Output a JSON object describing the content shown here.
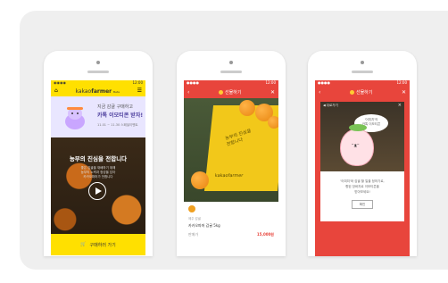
{
  "phone1": {
    "status": {
      "left": "◉◉◉◉",
      "right": "12:00"
    },
    "logo_prefix": "kakao",
    "logo_main": "farmer",
    "logo_suffix": "Beta",
    "banner_line1": "지금 감귤 구매하고",
    "banner_line2": "카톡 이모티콘 받자!",
    "banner_line3": "11.01 ~ 11.30 스페셜이벤트",
    "video_title": "농부의 진심을 전합니다",
    "video_sub1": "좋은 감귤을 재배하기 위해",
    "video_sub2": "농부의 노력과 정성을 담아",
    "video_sub3": "카카오파머가 전합니다",
    "buy_label": "구매하러 가기"
  },
  "phone2": {
    "status": {
      "left": "●●●●",
      "right": "12:00"
    },
    "title": "선물하기",
    "box_text1": "농부의 진심을",
    "box_text2": "전합니다",
    "box_brand": "kakaofarmer",
    "category": "제주 감귤",
    "product_name": "카카오파머 감귤 5kg",
    "price_label": "판매가",
    "price_value": "15,000원"
  },
  "phone3": {
    "status": {
      "left": "●●●●",
      "right": "12:00"
    },
    "title": "선물하기",
    "card_header": "◀ 뒤로가기",
    "bubble_line1": "'어피치'의",
    "bubble_line2": "카톡 이모티콘",
    "msg_line1": "'어피치'와 감귤 할 일을 정하기로,",
    "msg_line2": "향된 장바지로 이모티콘을",
    "msg_line3": "받아보세요!",
    "ok_label": "확인"
  },
  "colors": {
    "kakao_yellow": "#ffe000",
    "gift_red": "#e8453c",
    "orange": "#f0a020"
  }
}
